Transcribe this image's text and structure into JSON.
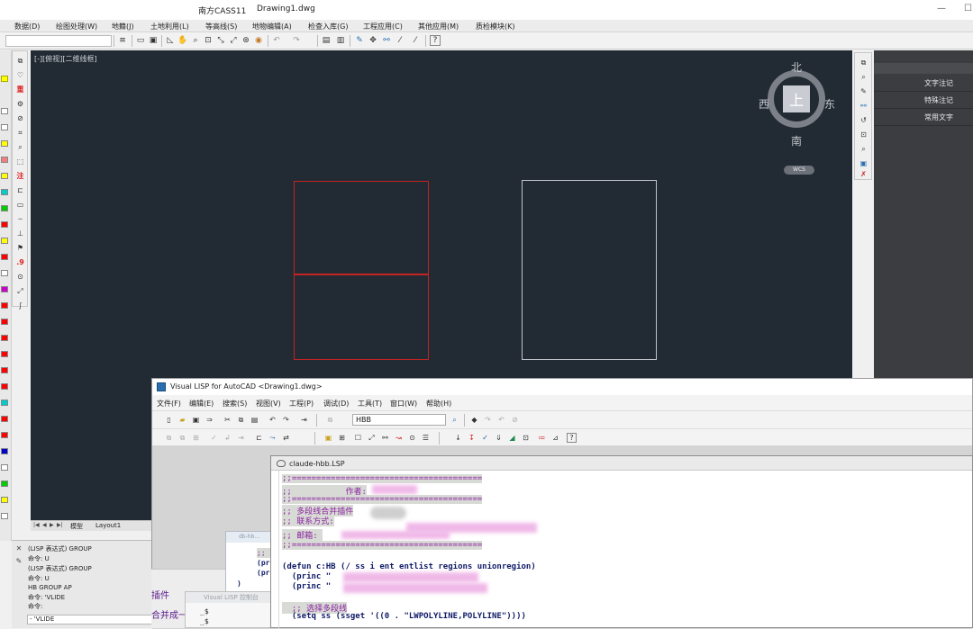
{
  "titlebar": {
    "app_title": "南方CASS11",
    "doc_title": "Drawing1.dwg"
  },
  "menus": [
    "数据(D)",
    "绘图处理(W)",
    "地籍(J)",
    "土地利用(L)",
    "等高线(S)",
    "地物编辑(A)",
    "检查入库(G)",
    "工程应用(C)",
    "其他应用(M)",
    "质检模块(K)"
  ],
  "canvas": {
    "view_label": "[-][俯视][二维线框]",
    "compass": {
      "north": "北",
      "south": "南",
      "west": "西",
      "east": "东",
      "cube": "上",
      "wcs": "WCS"
    }
  },
  "layout_tabs": [
    "模型",
    "Layout1"
  ],
  "right_panel": {
    "buttons": [
      "文字注记",
      "特殊注记",
      "常用文字"
    ]
  },
  "command_lines": [
    "(LISP 表达式) GROUP",
    "命令: U",
    "(LISP 表达式) GROUP",
    "命令: U",
    "HB GROUP AP",
    "命令: 'VLIDE",
    "命令:"
  ],
  "command_input": "- 'VLIDE",
  "vlisp": {
    "title": "Visual LISP for AutoCAD <Drawing1.dwg>",
    "menus": [
      "文件(F)",
      "编辑(E)",
      "搜索(S)",
      "视图(V)",
      "工程(P)",
      "调试(D)",
      "工具(T)",
      "窗口(W)",
      "帮助(H)"
    ],
    "combo_value": "HBB"
  },
  "editor": {
    "title": "claude-hbb.LSP",
    "lines": [
      ";;=======================================",
      ";;           作者:",
      ";;=======================================",
      ";; 多段线合并插件",
      ";; 联系方式:",
      ";; 邮箱: ",
      ";;=======================================",
      "(defun c:HB (/ ss i ent entlist regions unionregion)",
      "  (princ \"",
      "  (princ \"",
      "  ;; 选择多段线",
      "  (setq ss (ssget '((0 . \"LWPOLYLINE,POLYLINE\"))))"
    ]
  },
  "behind_windows": {
    "lisp_title": "db-hb...",
    "lisp_lines": [
      ";; 安",
      "(pr",
      "(pr",
      ")"
    ],
    "bg_text_1": "插件",
    "bg_text_2": "合并成一",
    "console_title": "Visual LISP 控制台",
    "console_lines": [
      "_$",
      "_$"
    ]
  }
}
